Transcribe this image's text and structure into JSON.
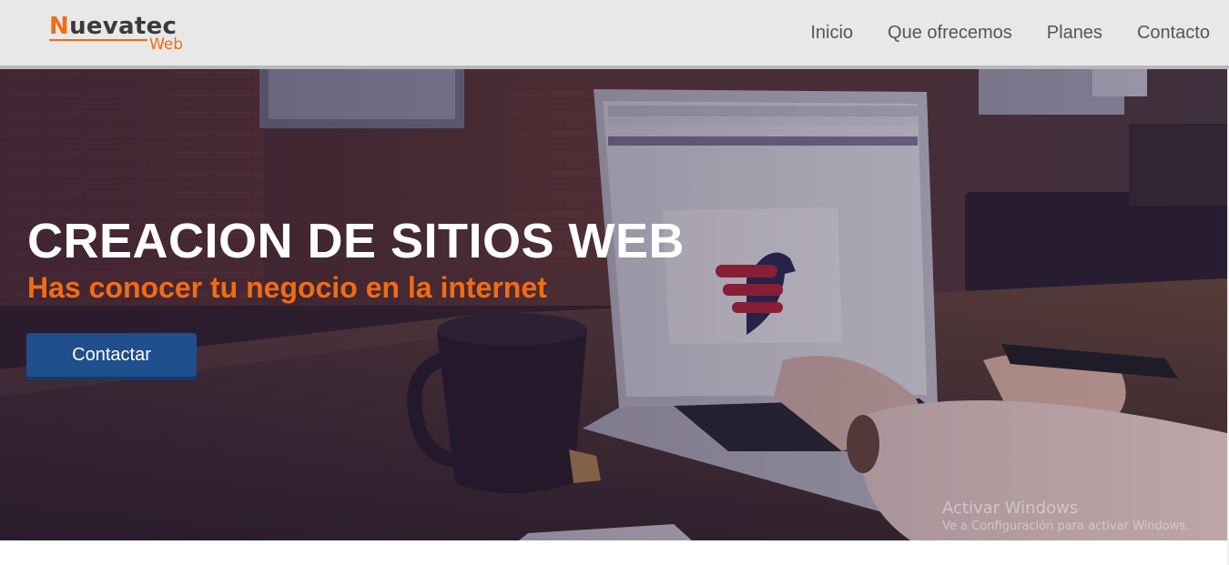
{
  "header": {
    "logo": {
      "main_first": "N",
      "main_rest": "uevatec",
      "sub": "Web"
    },
    "nav": [
      "Inicio",
      "Que ofrecemos",
      "Planes",
      "Contacto"
    ]
  },
  "hero": {
    "title": "CREACION DE SITIOS WEB",
    "subtitle": "Has conocer tu negocio en la internet",
    "button_label": "Contactar"
  },
  "watermark": {
    "title": "Activar Windows",
    "subtitle": "Ve a Configuración para activar Windows."
  },
  "colors": {
    "accent_orange": "#f36c12",
    "button_blue": "#1f4f8c",
    "header_bg": "#e8e8e8",
    "nav_text": "#555555"
  }
}
